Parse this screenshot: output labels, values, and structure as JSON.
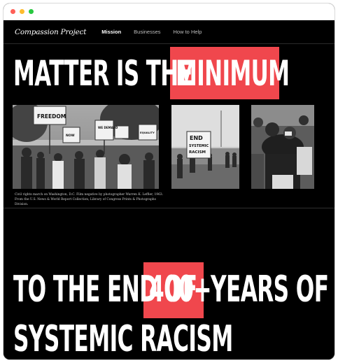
{
  "nav": {
    "logo": "Compassion Project",
    "links": [
      "Mission",
      "Businesses",
      "How to Help"
    ]
  },
  "hero": {
    "line1_prefix": "MATTER IS THE",
    "line1_highlight": "MINIMUM",
    "caption": "Civil rights march on Washington, D.C. Film negative by photographer Warren K. Leffler, 1963. From the U.S. News & World Report Collection, Library of Congress Prints & Photographs Division."
  },
  "photos": {
    "photo1_signs": [
      "FREEDOM",
      "WE DEMAND",
      "NOW",
      "EQUALITY"
    ],
    "photo2_sign": [
      "END",
      "SYSTEMIC",
      "RACISM"
    ]
  },
  "section2": {
    "line1_prefix": "TO THE END OF",
    "line1_highlight": "400+",
    "line1_suffix": "YEARS OF",
    "line2": "SYSTEMIC RACISM"
  },
  "colors": {
    "accent": "#f0474d",
    "background": "#000000",
    "text": "#ffffff"
  }
}
